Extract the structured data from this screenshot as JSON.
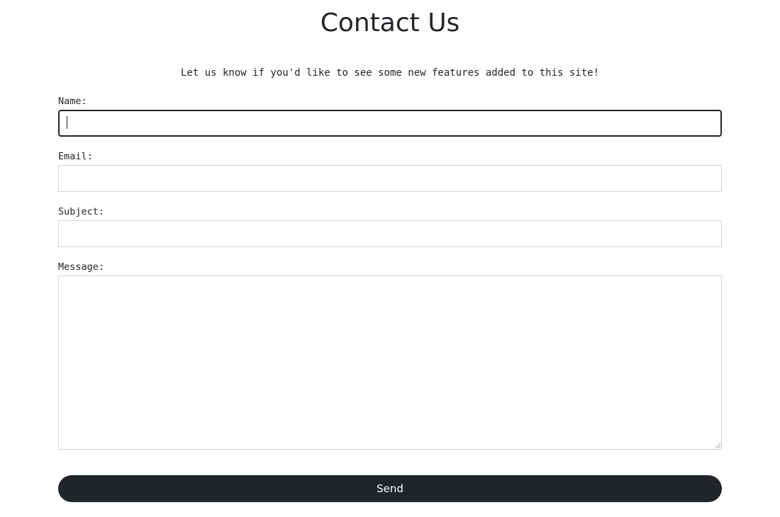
{
  "page": {
    "title": "Contact Us",
    "intro": "Let us know if you'd like to see some new features added to this site!"
  },
  "form": {
    "name_label": "Name:",
    "name_value": "",
    "email_label": "Email:",
    "email_value": "",
    "subject_label": "Subject:",
    "subject_value": "",
    "message_label": "Message:",
    "message_value": "",
    "send_label": "Send"
  },
  "colors": {
    "text": "#212529",
    "button_bg": "#212529",
    "button_text": "#ffffff",
    "input_border": "#ced4da",
    "background": "#ffffff"
  }
}
